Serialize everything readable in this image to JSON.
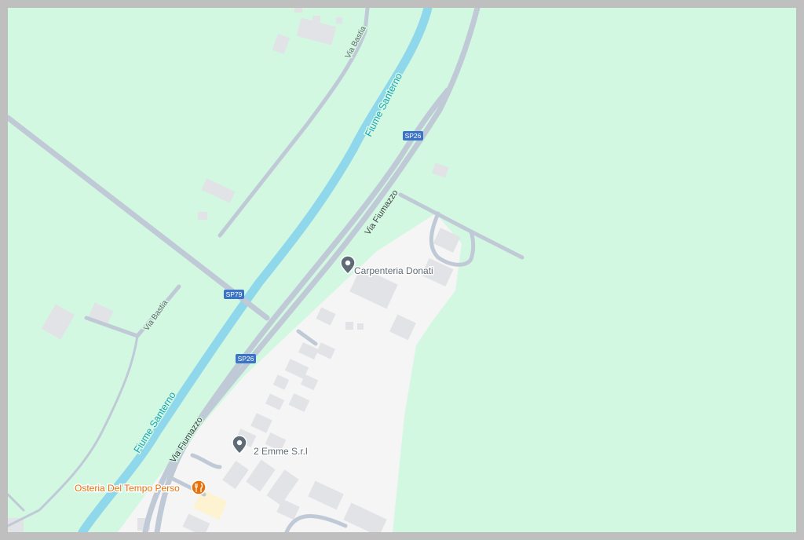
{
  "map": {
    "waterways": [
      {
        "id": "river-upper",
        "label": "Fiume Santerno"
      },
      {
        "id": "river-lower",
        "label": "Fiume Santerno"
      }
    ],
    "streets": {
      "via_bastia_north": "Via Bastia",
      "via_bastia_south": "Via Bastia",
      "via_fiumazzo_north": "Via Fiumazzo",
      "via_fiumazzo_south": "Via Fiumazzo"
    },
    "road_shields": {
      "sp26_north": "SP26",
      "sp79": "SP79",
      "sp26_south": "SP26"
    },
    "pois": [
      {
        "id": "carpenteria",
        "label": "Carpenteria Donati",
        "icon": "place-pin-icon",
        "color": "#5f6b75"
      },
      {
        "id": "due-emme",
        "label": "2 Emme S.r.l",
        "icon": "place-pin-icon",
        "color": "#5f6b75"
      },
      {
        "id": "osteria",
        "label": "Osteria Del Tempo Perso",
        "icon": "restaurant-icon",
        "color": "#e8710a"
      }
    ],
    "colors": {
      "land": "#d3f8e2",
      "urban": "#f5f5f5",
      "road": "#c0cad6",
      "water": "#8fd7ea",
      "water_label": "#1aa3b8",
      "shield": "#3b74c6",
      "restaurant": "#e8710a"
    }
  }
}
